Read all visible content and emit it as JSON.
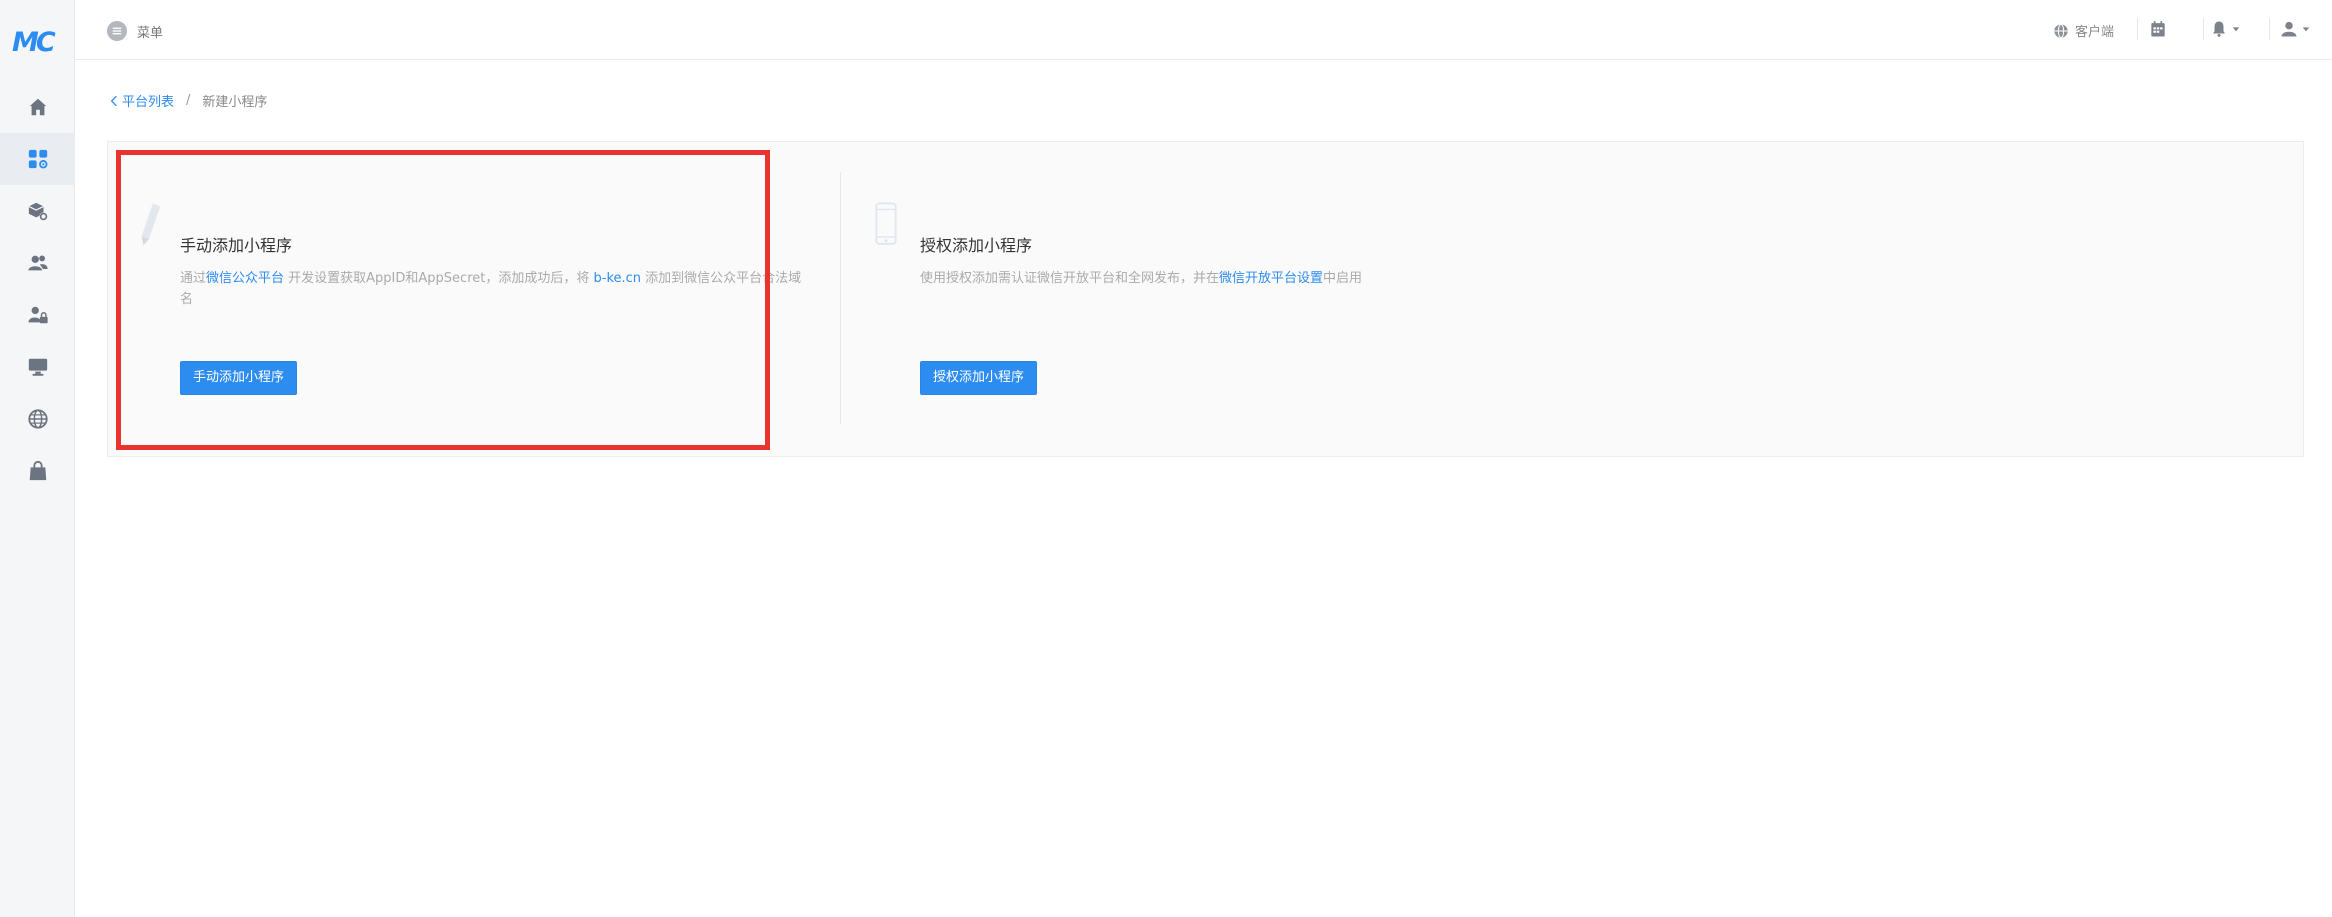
{
  "app": {
    "logo_text": "MC",
    "brand_color": "#2d8cf0"
  },
  "sidebar": {
    "items": [
      {
        "icon": "home-icon",
        "active": false
      },
      {
        "icon": "apps-icon",
        "active": true
      },
      {
        "icon": "box-settings-icon",
        "active": false
      },
      {
        "icon": "users-icon",
        "active": false
      },
      {
        "icon": "user-lock-icon",
        "active": false
      },
      {
        "icon": "monitor-icon",
        "active": false
      },
      {
        "icon": "globe-icon",
        "active": false
      },
      {
        "icon": "bag-icon",
        "active": false
      }
    ]
  },
  "topbar": {
    "menu_label": "菜单",
    "client_label": "客户端"
  },
  "breadcrumb": {
    "back_label": "平台列表",
    "separator": "/",
    "current": "新建小程序"
  },
  "cards": {
    "manual": {
      "title": "手动添加小程序",
      "desc_prefix": "通过",
      "desc_link1": "微信公众平台",
      "desc_mid": " 开发设置获取AppID和AppSecret，添加成功后，将 ",
      "desc_link2": "b-ke.cn",
      "desc_suffix": " 添加到微信公众平台合法域名",
      "button_label": "手动添加小程序"
    },
    "auth": {
      "title": "授权添加小程序",
      "desc_prefix": "使用授权添加需认证微信开放平台和全网发布，并在",
      "desc_link": "微信开放平台设置",
      "desc_suffix": "中启用",
      "button_label": "授权添加小程序"
    }
  },
  "colors": {
    "highlight": "#e8332f",
    "link": "#2d8cf0",
    "button": "#2d8cf0"
  }
}
